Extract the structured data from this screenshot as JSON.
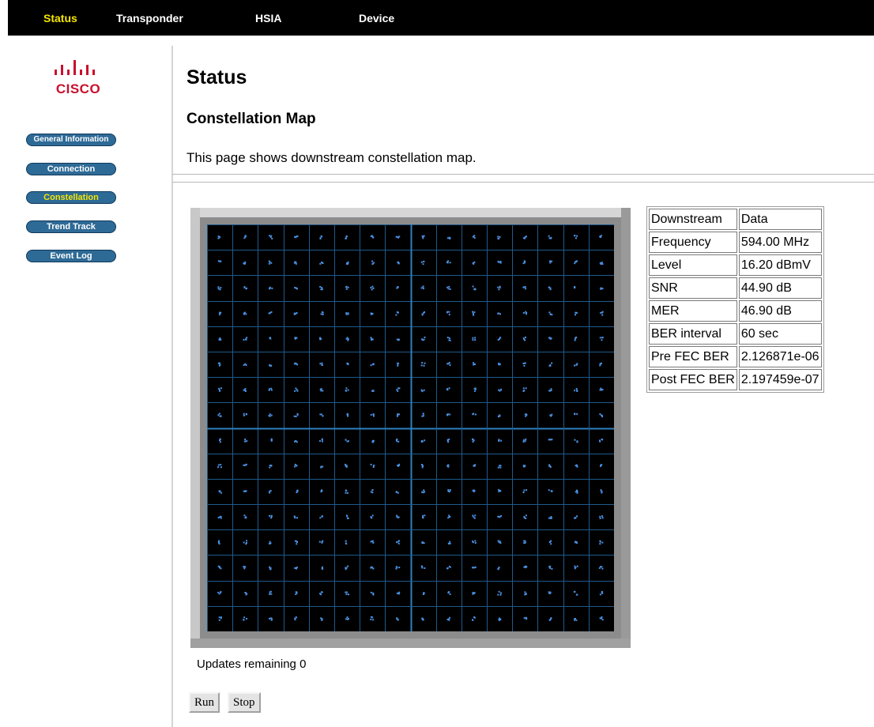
{
  "top_nav": [
    {
      "label": "Status",
      "active": true
    },
    {
      "label": "Transponder",
      "active": false
    },
    {
      "label": "HSIA",
      "active": false
    },
    {
      "label": "Device",
      "active": false
    }
  ],
  "logo": {
    "text": "CISCO"
  },
  "sidebar": [
    {
      "label": "General Information",
      "active": false
    },
    {
      "label": "Connection",
      "active": false
    },
    {
      "label": "Constellation",
      "active": true
    },
    {
      "label": "Trend Track",
      "active": false
    },
    {
      "label": "Event Log",
      "active": false
    }
  ],
  "page": {
    "title": "Status",
    "subtitle": "Constellation Map",
    "description": "This page shows downstream constellation map."
  },
  "stats_table": [
    [
      "Downstream",
      "Data"
    ],
    [
      "Frequency",
      "594.00 MHz"
    ],
    [
      "Level",
      "16.20 dBmV"
    ],
    [
      "SNR",
      "44.90 dB"
    ],
    [
      "MER",
      "46.90 dB"
    ],
    [
      "BER interval",
      "60 sec"
    ],
    [
      "Pre FEC BER",
      "2.126871e-06"
    ],
    [
      "Post FEC BER",
      "2.197459e-07"
    ]
  ],
  "constellation": {
    "grid_size": 16,
    "grid_color": "#1e5a8c",
    "axis_color": "#2e7fc0",
    "point_color": "#4a90e2",
    "background": "#000000"
  },
  "updates": {
    "text": "Updates remaining 0"
  },
  "buttons": {
    "run": "Run",
    "stop": "Stop"
  },
  "colors": {
    "active_nav": "#f5e600",
    "sidebar_button": "#2e6a96"
  }
}
